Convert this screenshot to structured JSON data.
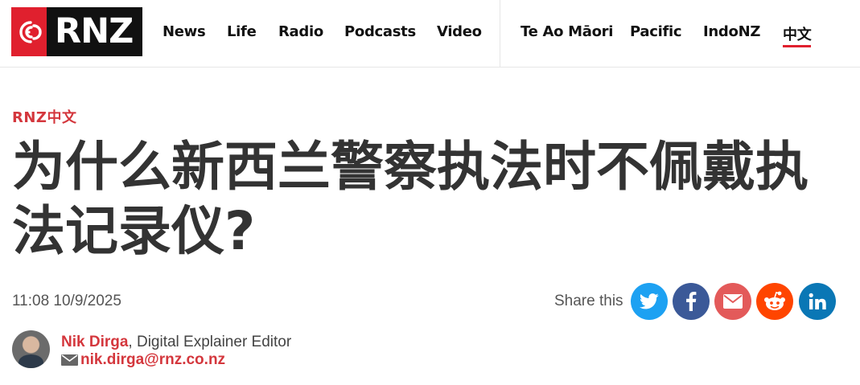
{
  "logo": {
    "text": "RNZ"
  },
  "nav": {
    "main": [
      "News",
      "Life",
      "Radio",
      "Podcasts",
      "Video"
    ],
    "alt": [
      "Te Ao Māori",
      "Pacific",
      "IndoNZ",
      "中文"
    ]
  },
  "article": {
    "kicker": "RNZ中文",
    "headline": "为什么新西兰警察执法时不佩戴执法记录仪?",
    "timestamp": "11:08 10/9/2025"
  },
  "share": {
    "label": "Share this",
    "icons": [
      "twitter-icon",
      "facebook-icon",
      "email-icon",
      "reddit-icon",
      "linkedin-icon"
    ]
  },
  "author": {
    "name": "Nik Dirga",
    "role": ", Digital Explainer Editor",
    "email": "nik.dirga@rnz.co.nz"
  },
  "colors": {
    "brand_red": "#e0202e",
    "link_red": "#d4373d",
    "twitter": "#1da1f2",
    "facebook": "#3b5998",
    "email": "#e35a5a",
    "reddit": "#ff4500",
    "linkedin": "#0a77b5"
  }
}
